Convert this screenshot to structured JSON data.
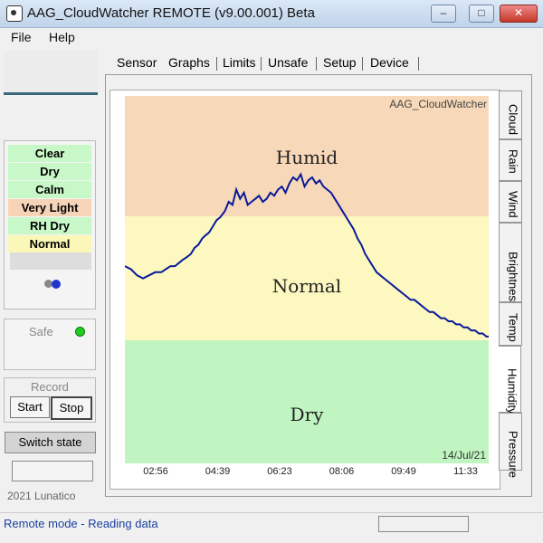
{
  "window": {
    "title": "AAG_CloudWatcher REMOTE (v9.00.001) Beta",
    "minimize": "–",
    "maximize": "□",
    "close": "✕"
  },
  "menu": {
    "file": "File",
    "help": "Help"
  },
  "status": {
    "rows": [
      {
        "label": "Clear",
        "color": "#c8f7c8"
      },
      {
        "label": "Dry",
        "color": "#c8f7c8"
      },
      {
        "label": "Calm",
        "color": "#c8f7c8"
      },
      {
        "label": "Very Light",
        "color": "#f7d3b8"
      },
      {
        "label": "RH Dry",
        "color": "#c8f7c8"
      },
      {
        "label": "Normal",
        "color": "#fbf7b8"
      }
    ]
  },
  "safe": {
    "label": "Safe"
  },
  "record": {
    "label": "Record",
    "start": "Start",
    "stop": "Stop"
  },
  "switch_state": "Switch state",
  "copyright": "2021 Lunatico",
  "tabs": [
    "Sensor",
    "Graphs",
    "Limits",
    "Unsafe",
    "Setup",
    "Device"
  ],
  "active_tab": "Graphs",
  "side_tabs": [
    "Cloud",
    "Rain",
    "Wind",
    "Brightness",
    "Temp",
    "Humidity",
    "Pressure"
  ],
  "active_side_tab": "Humidity",
  "chart": {
    "brand": "AAG_CloudWatcher",
    "date": "14/Jul/21",
    "bands": [
      {
        "label": "Humid",
        "color": "#f7d8b8"
      },
      {
        "label": "Normal",
        "color": "#fcf8c0"
      },
      {
        "label": "Dry",
        "color": "#c0f4c0"
      }
    ],
    "line_color": "#0a1a9a"
  },
  "chart_data": {
    "type": "line",
    "x_ticks": [
      "02:56",
      "04:39",
      "06:23",
      "08:06",
      "09:49",
      "11:33"
    ],
    "series": [
      {
        "x": [
          0.0,
          0.4,
          0.8,
          1.2,
          1.6,
          2.0,
          2.4,
          2.7,
          3.0,
          3.3,
          3.55,
          3.8,
          4.1,
          4.35,
          4.6,
          4.85,
          5.1,
          5.3,
          5.55,
          5.8,
          6.05,
          6.3,
          6.6,
          6.85,
          7.1,
          7.35,
          7.6,
          7.85,
          8.1,
          8.35,
          8.6,
          8.85,
          9.1,
          9.35,
          9.6,
          9.85,
          10.1,
          10.35,
          10.6,
          10.85,
          11.1,
          11.35,
          11.6,
          11.85,
          12.1,
          12.35,
          12.6,
          12.85,
          13.1,
          13.35,
          13.6,
          13.85,
          14.1,
          14.35,
          14.6,
          14.85,
          15.1,
          15.35,
          15.6,
          15.85,
          16.1,
          16.35,
          16.6,
          16.85,
          17.1,
          17.35,
          17.6,
          17.85,
          18.1,
          18.35,
          18.6,
          18.85,
          19.1,
          19.35,
          19.6,
          19.85,
          20.1,
          20.35,
          20.6,
          20.85,
          21.1,
          21.35,
          21.6,
          21.85,
          22.1,
          22.35,
          22.6,
          22.85,
          23.1,
          23.35,
          23.6,
          23.85,
          24.0
        ],
        "values": [
          5,
          4,
          2,
          1,
          2,
          3,
          3,
          4,
          5,
          5,
          6,
          7,
          8,
          9,
          11,
          12,
          14,
          15,
          16,
          18,
          20,
          21,
          23,
          26,
          25,
          30,
          27,
          29,
          25,
          26,
          27,
          28,
          26,
          27,
          29,
          28,
          30,
          31,
          29,
          32,
          34,
          33,
          35,
          31,
          33,
          34,
          32,
          33,
          31,
          30,
          29,
          27,
          25,
          23,
          21,
          19,
          17,
          14,
          12,
          9,
          7,
          5,
          3,
          2,
          1,
          0,
          -1,
          -2,
          -3,
          -4,
          -5,
          -6,
          -6,
          -7,
          -8,
          -9,
          -10,
          -10,
          -11,
          -12,
          -12,
          -13,
          -13,
          -14,
          -14,
          -15,
          -15,
          -16,
          -16,
          -17,
          -17,
          -18,
          -18
        ]
      }
    ]
  },
  "statusbar": {
    "text": "Remote mode - Reading data"
  }
}
